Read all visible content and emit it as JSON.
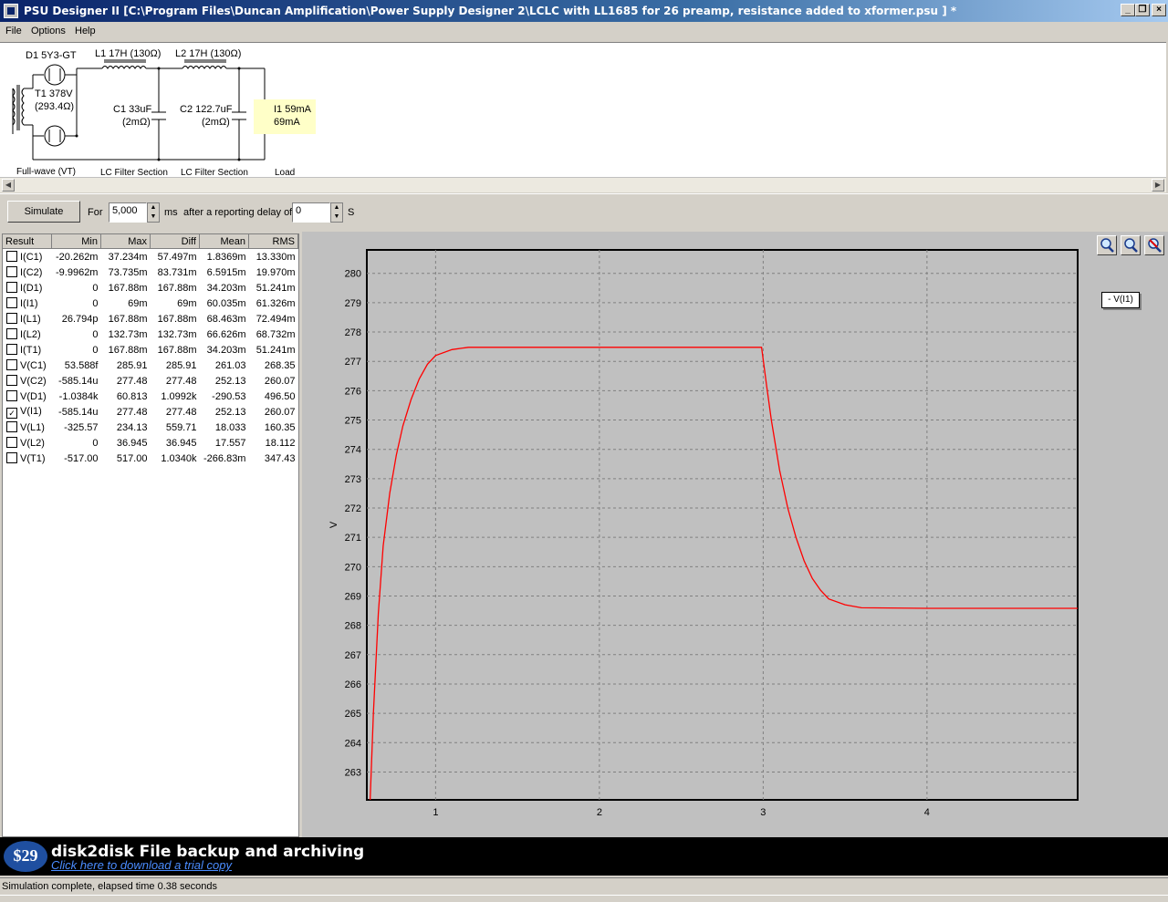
{
  "window": {
    "title": "PSU Designer II  [C:\\Program Files\\Duncan Amplification\\Power Supply Designer 2\\LCLC with LL1685 for 26 preamp, resistance added to xformer.psu ] *"
  },
  "menu": {
    "items": [
      "File",
      "Options",
      "Help"
    ]
  },
  "schematic": {
    "d1": "D1 5Y3-GT",
    "l1": "L1 17H (130Ω)",
    "l2": "L2 17H (130Ω)",
    "t1_line1": "T1 378V",
    "t1_line2": "(293.4Ω)",
    "c1_line1": "C1 33uF",
    "c1_line2": "(2mΩ)",
    "c2_line1": "C2 122.7uF",
    "c2_line2": "(2mΩ)",
    "i1_line1": "I1 59mA",
    "i1_line2": "69mA",
    "section1": "Full-wave (VT)",
    "section2": "LC Filter Section",
    "section3": "LC Filter Section",
    "section4": "Load"
  },
  "toolbar": {
    "simulate": "Simulate",
    "for_label": "For",
    "duration": "5,000",
    "ms_label": "ms",
    "delay_label": "after a reporting delay of",
    "delay": "0",
    "s_label": "S"
  },
  "results": {
    "headers": [
      "Result",
      "Min",
      "Max",
      "Diff",
      "Mean",
      "RMS"
    ],
    "rows": [
      {
        "name": "I(C1)",
        "min": "-20.262m",
        "max": "37.234m",
        "diff": "57.497m",
        "mean": "1.8369m",
        "rms": "13.330m",
        "checked": false
      },
      {
        "name": "I(C2)",
        "min": "-9.9962m",
        "max": "73.735m",
        "diff": "83.731m",
        "mean": "6.5915m",
        "rms": "19.970m",
        "checked": false
      },
      {
        "name": "I(D1)",
        "min": "0",
        "max": "167.88m",
        "diff": "167.88m",
        "mean": "34.203m",
        "rms": "51.241m",
        "checked": false
      },
      {
        "name": "I(I1)",
        "min": "0",
        "max": "69m",
        "diff": "69m",
        "mean": "60.035m",
        "rms": "61.326m",
        "checked": false
      },
      {
        "name": "I(L1)",
        "min": "26.794p",
        "max": "167.88m",
        "diff": "167.88m",
        "mean": "68.463m",
        "rms": "72.494m",
        "checked": false
      },
      {
        "name": "I(L2)",
        "min": "0",
        "max": "132.73m",
        "diff": "132.73m",
        "mean": "66.626m",
        "rms": "68.732m",
        "checked": false
      },
      {
        "name": "I(T1)",
        "min": "0",
        "max": "167.88m",
        "diff": "167.88m",
        "mean": "34.203m",
        "rms": "51.241m",
        "checked": false
      },
      {
        "name": "V(C1)",
        "min": "53.588f",
        "max": "285.91",
        "diff": "285.91",
        "mean": "261.03",
        "rms": "268.35",
        "checked": false
      },
      {
        "name": "V(C2)",
        "min": "-585.14u",
        "max": "277.48",
        "diff": "277.48",
        "mean": "252.13",
        "rms": "260.07",
        "checked": false
      },
      {
        "name": "V(D1)",
        "min": "-1.0384k",
        "max": "60.813",
        "diff": "1.0992k",
        "mean": "-290.53",
        "rms": "496.50",
        "checked": false
      },
      {
        "name": "V(I1)",
        "min": "-585.14u",
        "max": "277.48",
        "diff": "277.48",
        "mean": "252.13",
        "rms": "260.07",
        "checked": true
      },
      {
        "name": "V(L1)",
        "min": "-325.57",
        "max": "234.13",
        "diff": "559.71",
        "mean": "18.033",
        "rms": "160.35",
        "checked": false
      },
      {
        "name": "V(L2)",
        "min": "0",
        "max": "36.945",
        "diff": "36.945",
        "mean": "17.557",
        "rms": "18.112",
        "checked": false
      },
      {
        "name": "V(T1)",
        "min": "-517.00",
        "max": "517.00",
        "diff": "1.0340k",
        "mean": "-266.83m",
        "rms": "347.43",
        "checked": false
      }
    ]
  },
  "legend": "- V(I1)",
  "chart_data": {
    "type": "line",
    "ylabel": "V",
    "xlim": [
      0.58,
      4.92
    ],
    "ylim": [
      262.05,
      280.8
    ],
    "x_ticks": [
      1,
      2,
      3,
      4
    ],
    "y_ticks": [
      263,
      264,
      265,
      266,
      267,
      268,
      269,
      270,
      271,
      272,
      273,
      274,
      275,
      276,
      277,
      278,
      279,
      280
    ],
    "grid": true,
    "series": [
      {
        "name": "V(I1)",
        "color": "#ff0000",
        "points": [
          [
            0.6,
            262.0
          ],
          [
            0.62,
            265.0
          ],
          [
            0.65,
            268.4
          ],
          [
            0.68,
            270.7
          ],
          [
            0.72,
            272.5
          ],
          [
            0.76,
            273.8
          ],
          [
            0.8,
            274.8
          ],
          [
            0.85,
            275.7
          ],
          [
            0.9,
            276.4
          ],
          [
            0.95,
            276.9
          ],
          [
            1.0,
            277.2
          ],
          [
            1.1,
            277.4
          ],
          [
            1.2,
            277.48
          ],
          [
            2.0,
            277.48
          ],
          [
            2.99,
            277.48
          ],
          [
            3.02,
            276.2
          ],
          [
            3.05,
            275.0
          ],
          [
            3.1,
            273.3
          ],
          [
            3.15,
            272.0
          ],
          [
            3.2,
            271.0
          ],
          [
            3.25,
            270.2
          ],
          [
            3.3,
            269.6
          ],
          [
            3.35,
            269.2
          ],
          [
            3.4,
            268.9
          ],
          [
            3.5,
            268.7
          ],
          [
            3.6,
            268.6
          ],
          [
            4.0,
            268.58
          ],
          [
            4.92,
            268.58
          ]
        ]
      }
    ]
  },
  "ad": {
    "price": "$29",
    "title": "disk2disk File backup and archiving",
    "link": "Click here to download a trial copy"
  },
  "status": "Simulation complete, elapsed time 0.38 seconds"
}
